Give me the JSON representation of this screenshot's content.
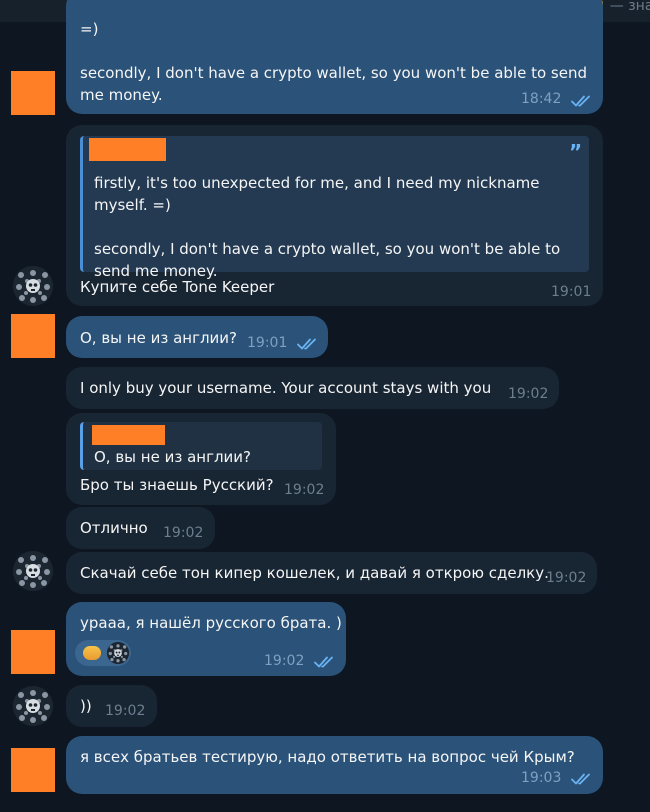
{
  "header": {
    "peek_text": "— зна"
  },
  "messages": {
    "m1": {
      "line1": "=)",
      "line2": "secondly, I don't have a crypto wallet, so you won't be able to send",
      "line3": "me money.",
      "time": "18:42"
    },
    "m2": {
      "quote_l1": "firstly, it's too unexpected for me, and I need my nickname",
      "quote_l2": "myself. =)",
      "quote_l3": "secondly, I don't have a crypto wallet, so you won't be able to",
      "quote_l4": "send me money.",
      "quote_mark": "”",
      "text": "Купите себе Tone Keeper",
      "time": "19:01"
    },
    "m3": {
      "text": "О, вы не из англии?",
      "time": "19:01"
    },
    "m4": {
      "text": "I only buy your username. Your account stays with you",
      "time": "19:02"
    },
    "m5": {
      "quote": "О, вы не из англии?",
      "text": "Бро ты знаешь Русский?",
      "time": "19:02"
    },
    "m6": {
      "text": "Отлично",
      "time": "19:02"
    },
    "m7": {
      "text": "Скачай себе тон кипер кошелек, и давай я открою сделку.",
      "time": "19:02"
    },
    "m8": {
      "text": "урааа, я нашёл русского брата. )",
      "time": "19:02",
      "reaction_icon": "handshake-icon"
    },
    "m9": {
      "text": "))",
      "time": "19:02"
    },
    "m10": {
      "text": "я всех братьев тестирую, надо ответить на вопрос чей Крым?",
      "time": "19:03"
    }
  },
  "colors": {
    "background": "#0e1621",
    "outgoing_bubble": "#2b5278",
    "incoming_bubble": "#182533",
    "redaction": "#ff7f27",
    "read_checks": "#6ab3f3"
  }
}
